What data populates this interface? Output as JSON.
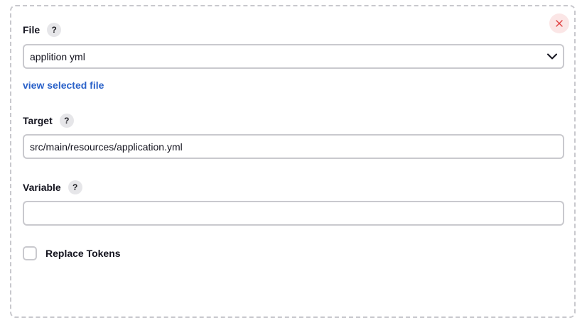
{
  "colors": {
    "link": "#2b62c9",
    "close_bg": "#fbe6e6",
    "close_icon": "#e04040",
    "border": "#c9c9ce"
  },
  "close_button": {
    "icon": "close-icon"
  },
  "file": {
    "label": "File",
    "help": "?",
    "selected_value": "applition yml",
    "view_link": "view selected file"
  },
  "target": {
    "label": "Target",
    "help": "?",
    "value": "src/main/resources/application.yml"
  },
  "variable": {
    "label": "Variable",
    "help": "?",
    "value": ""
  },
  "replace_tokens": {
    "label": "Replace Tokens",
    "checked": false
  }
}
